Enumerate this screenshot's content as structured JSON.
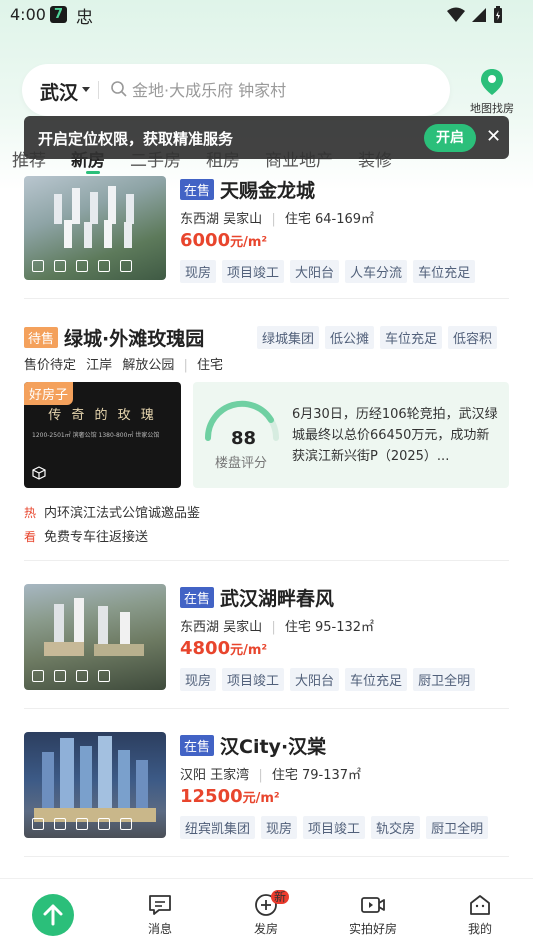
{
  "status_bar": {
    "time": "4:00",
    "app_icon_char": "7",
    "app_icon2_char": "忠"
  },
  "header": {
    "city": "武汉",
    "search_placeholder": "金地·大成乐府 钟家村",
    "map_label": "地图找房"
  },
  "tabs": [
    "推荐",
    "新房",
    "二手房",
    "租房",
    "商业地产",
    "装修"
  ],
  "toast": {
    "text": "开启定位权限，获取精准服务",
    "button": "开启",
    "close": "✕"
  },
  "listings": [
    {
      "status": "在售",
      "name": "天赐金龙城",
      "district": "东西湖",
      "area": "吴家山",
      "type": "住宅",
      "size": "64-169㎡",
      "price": "6000",
      "price_unit": "元/m²",
      "tags": [
        "现房",
        "项目竣工",
        "大阳台",
        "人车分流",
        "车位充足"
      ]
    },
    {
      "status": "待售",
      "name": "绿城·外滩玫瑰园",
      "header_tags": [
        "绿城集团",
        "低公摊",
        "车位充足",
        "低容积"
      ],
      "sub": {
        "price_status": "售价待定",
        "area1": "江岸",
        "area2": "解放公园",
        "type": "住宅"
      },
      "image_label": "好房子",
      "image_title": "传 奇 的 玫 瑰",
      "image_sub": "1200-2501㎡ 滨奢公馆   1380-800㎡ 世家公馆",
      "score": "88",
      "score_label": "楼盘评分",
      "score_text": "6月30日，历经106轮竞拍，武汉绿城最终以总价66450万元，成功新获滨江新兴街P（2025）...",
      "highlights": [
        {
          "icon": "热",
          "text": "内环滨江法式公馆诚邀品鉴"
        },
        {
          "icon": "看",
          "text": "免费专车往返接送"
        }
      ]
    },
    {
      "status": "在售",
      "name": "武汉湖畔春风",
      "district": "东西湖",
      "area": "吴家山",
      "type": "住宅",
      "size": "95-132㎡",
      "price": "4800",
      "price_unit": "元/m²",
      "tags": [
        "现房",
        "项目竣工",
        "大阳台",
        "车位充足",
        "厨卫全明"
      ]
    },
    {
      "status": "在售",
      "name": "汉City·汉棠",
      "district": "汉阳",
      "area": "王家湾",
      "type": "住宅",
      "size": "79-137㎡",
      "price": "12500",
      "price_unit": "元/m²",
      "tags": [
        "纽宾凯集团",
        "现房",
        "项目竣工",
        "轨交房",
        "厨卫全明"
      ]
    }
  ],
  "bottom_nav": {
    "items": [
      "消息",
      "发房",
      "实拍好房",
      "我的"
    ],
    "new_badge": "新"
  },
  "colors": {
    "accent": "#2bbf7a",
    "price": "#e8452d",
    "badge_sale": "#4263c5",
    "badge_pending": "#f4a15c"
  }
}
